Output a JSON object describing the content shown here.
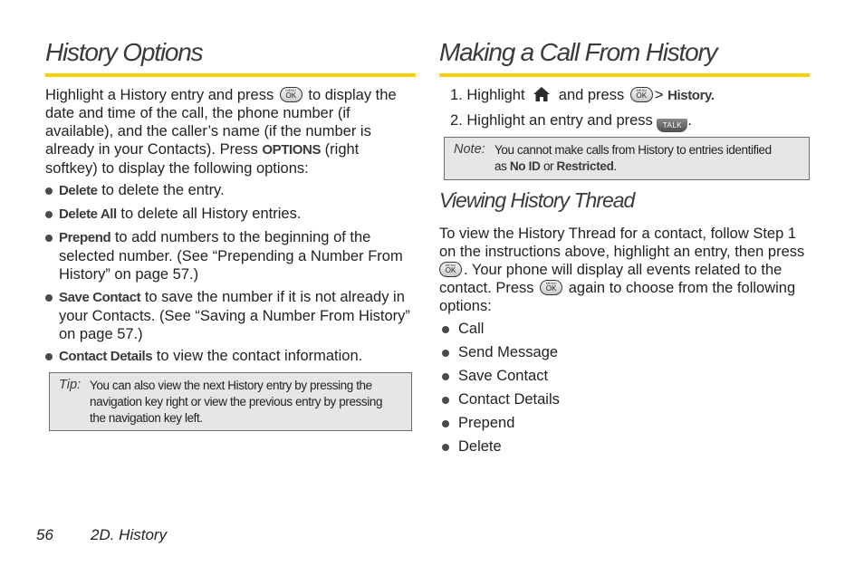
{
  "left": {
    "title": "History Options",
    "intro": {
      "line1a": "Highlight a History entry and press",
      "line1b": "to display the",
      "line2": "date and time of the call, the phone number (if",
      "line3": "available), and the caller’s name (if the number is",
      "line4a": "already in your Contacts). Press",
      "line4bold": "OPTIONS",
      "line4b": "(right",
      "line5": "softkey) to display the following options:"
    },
    "options": [
      {
        "bold": "Delete",
        "lines": [
          "to delete the entry."
        ]
      },
      {
        "bold": "Delete All",
        "lines": [
          "to delete all History entries."
        ]
      },
      {
        "bold": "Prepend",
        "lines": [
          "to add numbers to the beginning of the",
          "selected number. (See “Prepending a Number From",
          "History” on page 57.)"
        ]
      },
      {
        "bold": "Save Contact",
        "lines": [
          "to save the number if it is not already in",
          "your Contacts. (See “Saving a Number From History”",
          "on page 57.)"
        ]
      },
      {
        "bold": "Contact Details",
        "lines": [
          "to view the contact information."
        ]
      }
    ],
    "tip": {
      "label": "Tip:",
      "lines": [
        "You can also view the next History entry by pressing the",
        "navigation key right or view the previous entry by pressing",
        "the navigation key left."
      ]
    }
  },
  "right": {
    "title": "Making a Call From History",
    "steps": [
      {
        "num": "1.",
        "a": "Highlight",
        "b": "and press",
        "c": ">",
        "bold": "History."
      },
      {
        "num": "2.",
        "a": "Highlight an entry and press",
        "end": "."
      }
    ],
    "note": {
      "label": "Note:",
      "line1": "You cannot make calls from History to entries identified",
      "line2a": "as",
      "bold1": "No ID",
      "line2b": "or",
      "bold2": "Restricted",
      "line2c": "."
    },
    "subtitle": "Viewing History Thread",
    "thread": {
      "line1": "To view the History Thread for a contact, follow Step 1",
      "line2": "on the instructions above, highlight an entry, then press",
      "line3": ". Your phone will display all events related to the",
      "line4a": "contact. Press",
      "line4b": "again to choose from the following",
      "line5": "options:"
    },
    "thread_options": [
      "Call",
      "Send Message",
      "Save Contact",
      "Contact Details",
      "Prepend",
      "Delete"
    ]
  },
  "keys": {
    "menu": "MENU",
    "ok": "OK",
    "talk": "TALK"
  },
  "icons": {
    "home": "home-icon",
    "menu_ok": "menu-ok-key-icon",
    "talk": "talk-key-icon"
  },
  "footer": {
    "page_number": "56",
    "section": "2D. History"
  },
  "colors": {
    "accent_rule": "#f5d200",
    "note_bg": "#e6e6e6"
  }
}
